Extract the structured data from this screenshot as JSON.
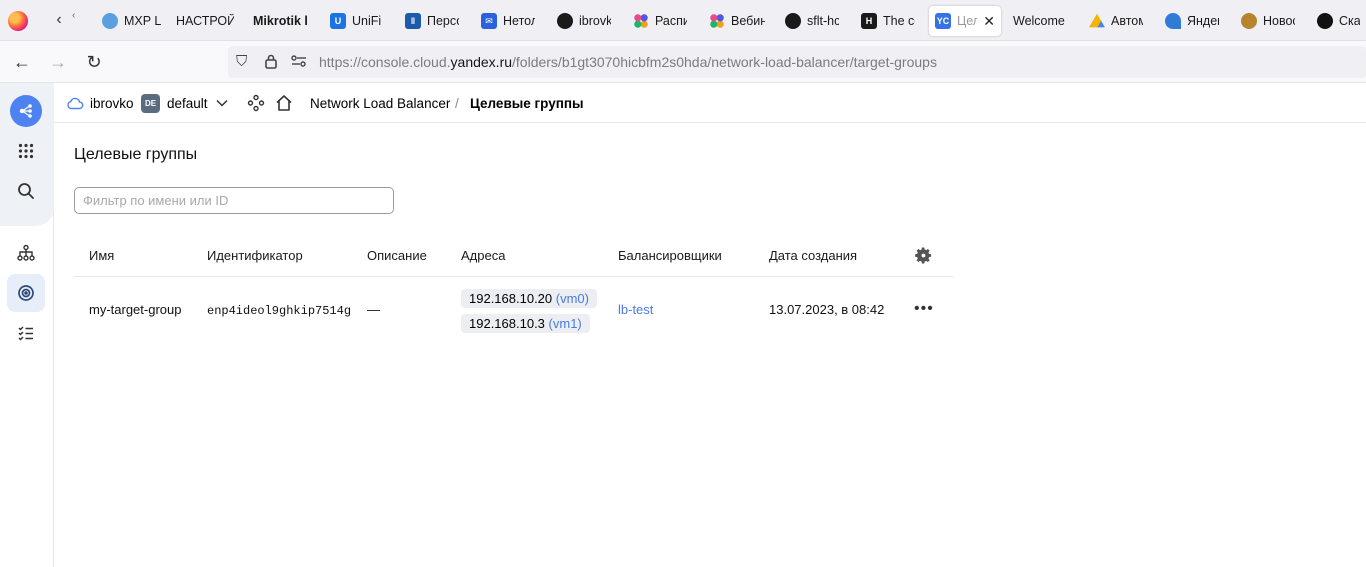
{
  "browser": {
    "tabs": [
      {
        "label": "MXP L",
        "icon": "globe-icon",
        "color": "#5aa0e0"
      },
      {
        "label": "НАСТРОЙ",
        "icon": "",
        "color": ""
      },
      {
        "label": "Mikrotik l",
        "icon": "",
        "color": ""
      },
      {
        "label": "UniFi l",
        "icon": "unifi-icon",
        "color": "#1b74e4"
      },
      {
        "label": "Персо",
        "icon": "wave-icon",
        "color": "#1d5aa8"
      },
      {
        "label": "Нетол",
        "icon": "mail-icon",
        "color": "#2a62d9"
      },
      {
        "label": "ibrovk",
        "icon": "github-icon",
        "color": "#1a1a1a"
      },
      {
        "label": "Распи",
        "icon": "dots-icon",
        "color": "#b44fd1"
      },
      {
        "label": "Вебин",
        "icon": "dots-icon",
        "color": "#b44fd1"
      },
      {
        "label": "sflt-hc",
        "icon": "github-icon",
        "color": "#1a1a1a"
      },
      {
        "label": "The co",
        "icon": "hashicorp-icon",
        "color": "#1a1a1a"
      },
      {
        "label": "Цел",
        "icon": "yc-icon",
        "color": "#3572e5",
        "badge": "YC",
        "active": true
      },
      {
        "label": "Welcome t",
        "icon": "",
        "color": ""
      },
      {
        "label": "Автом",
        "icon": "gdrive-icon",
        "color": "#f5b400"
      },
      {
        "label": "Яндек",
        "icon": "yandex-icon",
        "color": "#2e7bd8"
      },
      {
        "label": "Новос",
        "icon": "eagle-icon",
        "color": "#b8832f"
      },
      {
        "label": "Скача",
        "icon": "kali-icon",
        "color": "#111111"
      }
    ],
    "url": {
      "prefix": "https://console.cloud.",
      "domain": "yandex.ru",
      "path": "/folders/b1gt3070hicbfm2s0hda/network-load-balancer/target-groups"
    }
  },
  "header": {
    "cloud": "ibrovko",
    "folder_badge": "DE",
    "folder": "default",
    "breadcrumb_service": "Network Load Balancer",
    "breadcrumb_separator": "/",
    "breadcrumb_current": "Целевые группы"
  },
  "main": {
    "title": "Целевые группы",
    "filter_placeholder": "Фильтр по имени или ID",
    "columns": [
      "Имя",
      "Идентификатор",
      "Описание",
      "Адреса",
      "Балансировщики",
      "Дата создания"
    ],
    "rows": [
      {
        "name": "my-target-group",
        "id": "enp4ideol9ghkip7514g",
        "description": "—",
        "addresses": [
          {
            "ip": "192.168.10.20",
            "vm": "(vm0)"
          },
          {
            "ip": "192.168.10.3",
            "vm": "(vm1)"
          }
        ],
        "balancer": "lb-test",
        "created": "13.07.2023, в 08:42"
      }
    ]
  },
  "colors": {
    "accent": "#4e82f0",
    "link": "#4a7ae0"
  }
}
